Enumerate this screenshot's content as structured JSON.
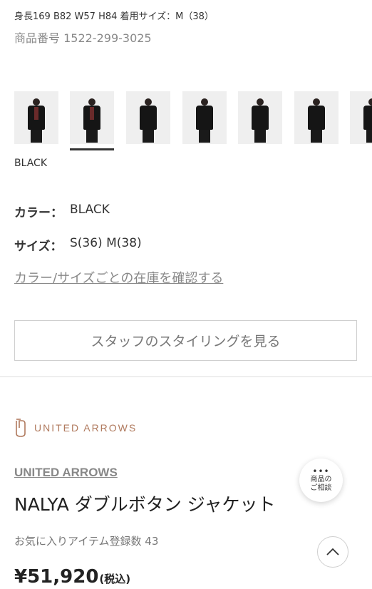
{
  "model_info": "身長169 B82 W57 H84 着用サイズ：M（38）",
  "product_code": "商品番号 1522-299-3025",
  "thumbnails": [
    {
      "label": "thumbnail-1"
    },
    {
      "label": "thumbnail-2"
    },
    {
      "label": "thumbnail-3"
    },
    {
      "label": "thumbnail-4"
    },
    {
      "label": "thumbnail-5"
    },
    {
      "label": "thumbnail-6"
    },
    {
      "label": "thumbnail-7"
    }
  ],
  "selected_color_caption": "BLACK",
  "specs": {
    "color_label": "カラー：",
    "color_value": "BLACK",
    "size_label": "サイズ：",
    "size_value": "S(36) M(38)"
  },
  "stock_link": "カラー/サイズごとの在庫を確認する",
  "staff_styling_button": "スタッフのスタイリングを見る",
  "brand": {
    "logo_text": "UNITED ARROWS",
    "link": "UNITED ARROWS"
  },
  "product_name": "NALYA ダブルボタン ジャケット",
  "favorite_count": "お気に入りアイテム登録数 43",
  "price": {
    "amount": "¥51,920",
    "tax_note": "(税込)"
  },
  "consult_button": {
    "dots": "•••",
    "line1": "商品の",
    "line2": "ご相談"
  },
  "colors": {
    "brand_accent": "#b07a5e",
    "muted_text": "#888888"
  },
  "icons": {
    "scroll_top": "chevron-up-icon",
    "consult": "chat-dots-icon"
  }
}
